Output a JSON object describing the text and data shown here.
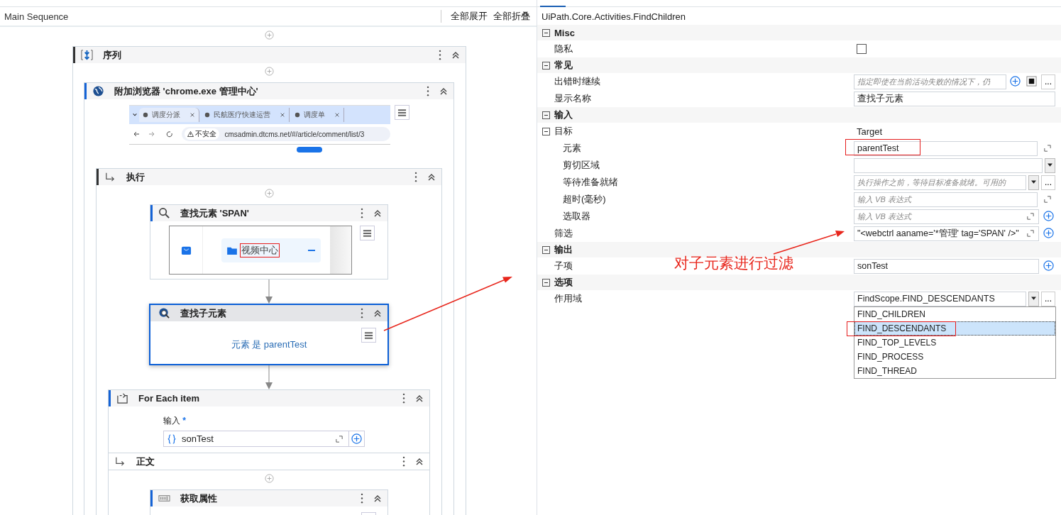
{
  "designer": {
    "title": "Main Sequence",
    "actions": [
      "全部展开",
      "全部折叠"
    ]
  },
  "workflow": {
    "sequence": {
      "title": "序列",
      "expanded": true
    },
    "attach": {
      "title": "附加浏览器 'chrome.exe  管理中心'",
      "expanded": true,
      "browser": {
        "tabs": [
          {
            "label": "调度分派",
            "selected": true
          },
          {
            "label": "民航医疗快速运营",
            "selected": false
          },
          {
            "label": "调度单",
            "selected": false
          }
        ],
        "insecure": "不安全",
        "url": "cmsadmin.dtcms.net/#/article/comment/list/3"
      }
    },
    "do": {
      "title": "执行",
      "expanded": true
    },
    "find_element": {
      "title": "查找元素 'SPAN'",
      "expanded": true,
      "preview_label": "视频中心"
    },
    "find_children": {
      "title": "查找子元素",
      "expanded": true,
      "selected": true,
      "summary": "元素 是 parentTest"
    },
    "for_each": {
      "title": "For Each item",
      "expanded": true,
      "input_label": "输入",
      "required_mark": "*",
      "input_value": "sonTest"
    },
    "body": {
      "title": "正文",
      "expanded": true
    },
    "get_attribute": {
      "title": "获取属性",
      "expanded": true
    }
  },
  "properties": {
    "class_name": "UiPath.Core.Activities.FindChildren",
    "sections": [
      {
        "title": "Misc",
        "expanded": true,
        "rows": [
          {
            "label": "隐私",
            "kind": "checkbox",
            "checked": false
          }
        ]
      },
      {
        "title": "常见",
        "expanded": true,
        "rows": [
          {
            "label": "出错时继续",
            "kind": "field",
            "placeholder": "指定即使在当前活动失败的情况下，仍",
            "add": true,
            "stop": true,
            "more": "..."
          },
          {
            "label": "显示名称",
            "kind": "field",
            "value": "查找子元素"
          }
        ]
      },
      {
        "title": "输入",
        "expanded": true,
        "rows": [
          {
            "label": "目标",
            "kind": "group",
            "expanded": true,
            "value": "Target",
            "children": [
              {
                "label": "元素",
                "kind": "field",
                "value": "parentTest",
                "expand": true,
                "annotated": true
              },
              {
                "label": "剪切区域",
                "kind": "field",
                "dropdown": true
              },
              {
                "label": "等待准备就绪",
                "kind": "field",
                "placeholder": "执行操作之前，等待目标准备就绪。可用的",
                "dropdown": true,
                "more": "..."
              },
              {
                "label": "超时(毫秒)",
                "kind": "field",
                "placeholder": "输入 VB 表达式",
                "expand": true
              },
              {
                "label": "选取器",
                "kind": "field",
                "placeholder": "输入 VB 表达式",
                "expand_inline": true,
                "add": true
              }
            ]
          },
          {
            "label": "筛选",
            "kind": "field",
            "value": "\"<webctrl aaname='*管理' tag='SPAN'  />\"",
            "expand_inline": true,
            "add": true
          }
        ]
      },
      {
        "title": "输出",
        "expanded": true,
        "rows": [
          {
            "label": "子项",
            "kind": "field",
            "value": "sonTest",
            "add": true
          }
        ]
      },
      {
        "title": "选项",
        "expanded": true,
        "rows": [
          {
            "label": "作用域",
            "kind": "field",
            "value": "FindScope.FIND_DESCENDANTS",
            "dropdown": true,
            "more": "...",
            "options": [
              {
                "label": "FIND_CHILDREN",
                "selected": false
              },
              {
                "label": "FIND_DESCENDANTS",
                "selected": true,
                "annotated": true
              },
              {
                "label": "FIND_TOP_LEVELS",
                "selected": false
              },
              {
                "label": "FIND_PROCESS",
                "selected": false
              },
              {
                "label": "FIND_THREAD",
                "selected": false
              }
            ]
          }
        ]
      }
    ]
  },
  "annotation": {
    "text": "对子元素进行过滤"
  }
}
